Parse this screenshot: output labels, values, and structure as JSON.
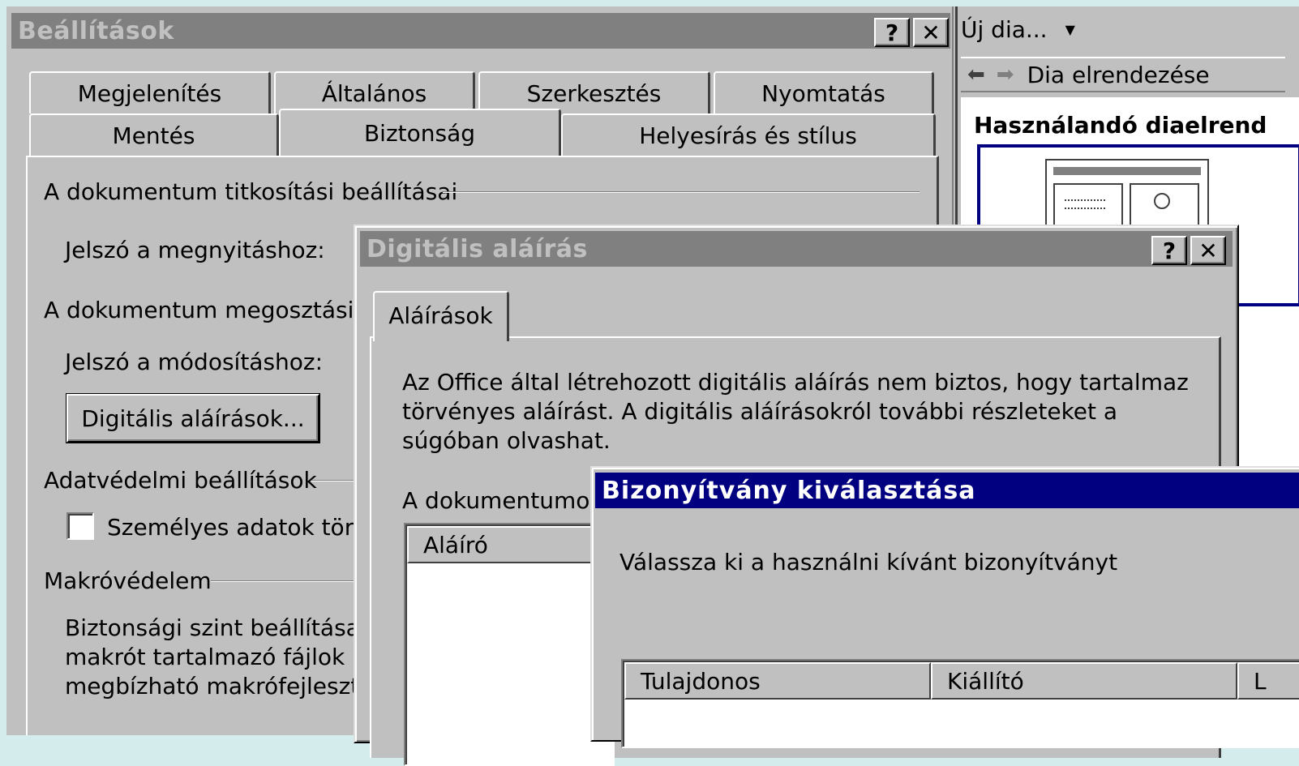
{
  "settings": {
    "title": "Beállítások",
    "help_btn": "?",
    "close_btn": "✕",
    "tabs_row1": [
      "Megjelenítés",
      "Általános",
      "Szerkesztés",
      "Nyomtatás"
    ],
    "tabs_row2": [
      "Mentés",
      "Biztonság",
      "Helyesírás és stílus"
    ],
    "encryption_group": "A dokumentum titkosítási beállításai",
    "open_password_label": "Jelszó a megnyitáshoz:",
    "sharing_group": "A dokumentum megosztási b",
    "modify_password_label": "Jelszó a módosításhoz:",
    "digital_signatures_button": "Digitális aláírások...",
    "privacy_group": "Adatvédelmi beállítások",
    "remove_personal_checkbox": "Személyes adatok törl",
    "macro_group": "Makróvédelem",
    "macro_text_1": "Biztonsági szint beállítása",
    "macro_text_2": "makrót  tartalmazó fájlok r",
    "macro_text_3": "megbízható makrófejlesztő"
  },
  "layout_pane": {
    "new_slide": "Új dia...",
    "back_icon": "arrow-left-icon",
    "forward_icon": "arrow-right-icon",
    "nav_title": "Dia elrendezése",
    "heading": "Használandó diaelrend"
  },
  "digsig": {
    "title": "Digitális aláírás",
    "help_btn": "?",
    "close_btn": "✕",
    "tab": "Aláírások",
    "info_line1": "Az Office által létrehozott digitális aláírás nem biztos, hogy tartalmaz",
    "info_line2": "törvényes aláírást. A digitális aláírásokról további részleteket a",
    "info_line3": "súgóban olvashat.",
    "doc_label": "A dokumentumot",
    "col_signer": "Aláíró"
  },
  "cert": {
    "title": "Bizonyítvány kiválasztása",
    "prompt": "Válassza ki a használni kívánt bizonyítványt",
    "col_owner": "Tulajdonos",
    "col_issuer": "Kiállító",
    "col_third": "L"
  },
  "colors": {
    "face": "#c0c0c0",
    "active_title": "#000080",
    "inactive_title": "#808080",
    "desktop": "#d4ecec"
  }
}
